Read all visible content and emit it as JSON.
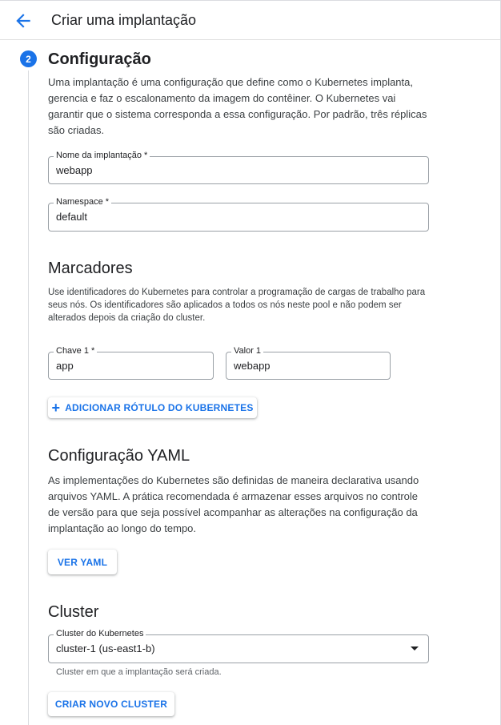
{
  "header": {
    "title": "Criar uma implantação"
  },
  "step": {
    "number": "2",
    "title": "Configuração",
    "description": "Uma implantação é uma configuração que define como o Kubernetes implanta, gerencia e faz o escalonamento da imagem do contêiner. O Kubernetes vai garantir que o sistema corresponda a essa configuração. Por padrão, três réplicas são criadas."
  },
  "fields": {
    "deployment_name": {
      "label": "Nome da implantação *",
      "value": "webapp"
    },
    "namespace": {
      "label": "Namespace *",
      "value": "default"
    }
  },
  "labels_section": {
    "title": "Marcadores",
    "description": "Use identificadores do Kubernetes para controlar a programação de cargas de trabalho para seus nós. Os identificadores são aplicados a todos os nós neste pool e não podem ser alterados depois da criação do cluster.",
    "key": {
      "label": "Chave 1 *",
      "value": "app"
    },
    "value": {
      "label": "Valor 1",
      "value": "webapp"
    },
    "add_button": "ADICIONAR RÓTULO DO KUBERNETES"
  },
  "yaml_section": {
    "title": "Configuração YAML",
    "description": "As implementações do Kubernetes são definidas de maneira declarativa usando arquivos YAML. A prática recomendada é armazenar esses arquivos no controle de versão para que seja possível acompanhar as alterações na configuração da implantação ao longo do tempo.",
    "button": "VER YAML"
  },
  "cluster_section": {
    "title": "Cluster",
    "select": {
      "label": "Cluster do Kubernetes",
      "value": "cluster-1 (us-east1-b)"
    },
    "helper": "Cluster em que a implantação será criada.",
    "button": "CRIAR NOVO CLUSTER"
  },
  "colors": {
    "accent": "#1a73e8",
    "border": "#9aa0a6",
    "divider": "#dadce0"
  },
  "icons": {
    "back": "arrow-back-icon",
    "add": "plus-icon",
    "dropdown": "dropdown-arrow-icon"
  }
}
